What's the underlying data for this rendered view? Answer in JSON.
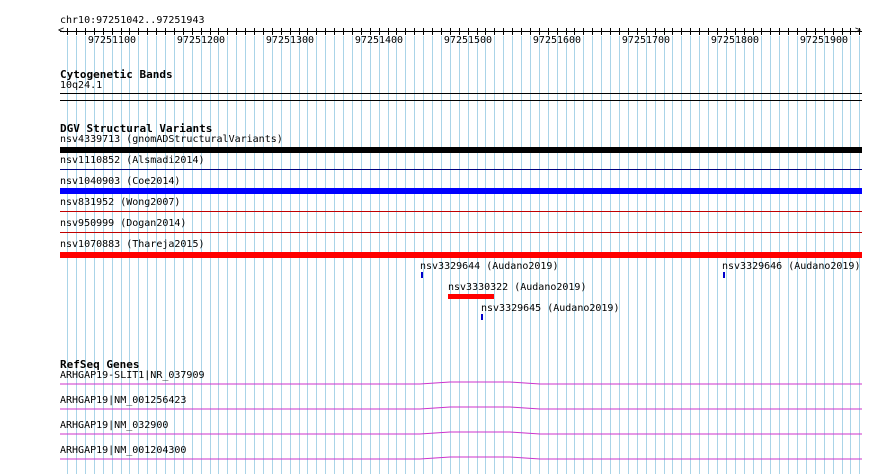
{
  "ruler": {
    "location": "chr10:97251042..97251943",
    "ticks": [
      "97251100",
      "97251200",
      "97251300",
      "97251400",
      "97251500",
      "97251600",
      "97251700",
      "97251800",
      "97251900"
    ]
  },
  "cytoband": {
    "title": "Cytogenetic Bands",
    "band": "10q24.1"
  },
  "dgv": {
    "title": "DGV Structural Variants",
    "rows": [
      {
        "label": "nsv4339713 (gnomADStructuralVariants)",
        "color": "#000000"
      },
      {
        "label": "nsv1110852 (Alsmadi2014)",
        "color": "#000080"
      },
      {
        "label": "nsv1040903 (Coe2014)",
        "color": "#0000ff"
      },
      {
        "label": "nsv831952 (Wong2007)",
        "color": "#c00000"
      },
      {
        "label": "nsv950999 (Dogan2014)",
        "color": "#c00000"
      },
      {
        "label": "nsv1070883 (Thareja2015)",
        "color": "#ff0000"
      }
    ],
    "small": [
      {
        "label": "nsv3329644 (Audano2019)",
        "color": "#0000cc"
      },
      {
        "label": "nsv3329646 (Audano2019)",
        "color": "#0000cc"
      },
      {
        "label": "nsv3330322 (Audano2019)",
        "color": "#ff0000"
      },
      {
        "label": "nsv3329645 (Audano2019)",
        "color": "#0000cc"
      }
    ]
  },
  "refseq": {
    "title": "RefSeq Genes",
    "genes": [
      {
        "label": "ARHGAP19-SLIT1|NR_037909"
      },
      {
        "label": "ARHGAP19|NM_001256423"
      },
      {
        "label": "ARHGAP19|NM_032900"
      },
      {
        "label": "ARHGAP19|NM_001204300"
      }
    ],
    "color": "#cc33cc"
  },
  "colors": {
    "grid": "#aad4e8",
    "line": "#000000"
  }
}
